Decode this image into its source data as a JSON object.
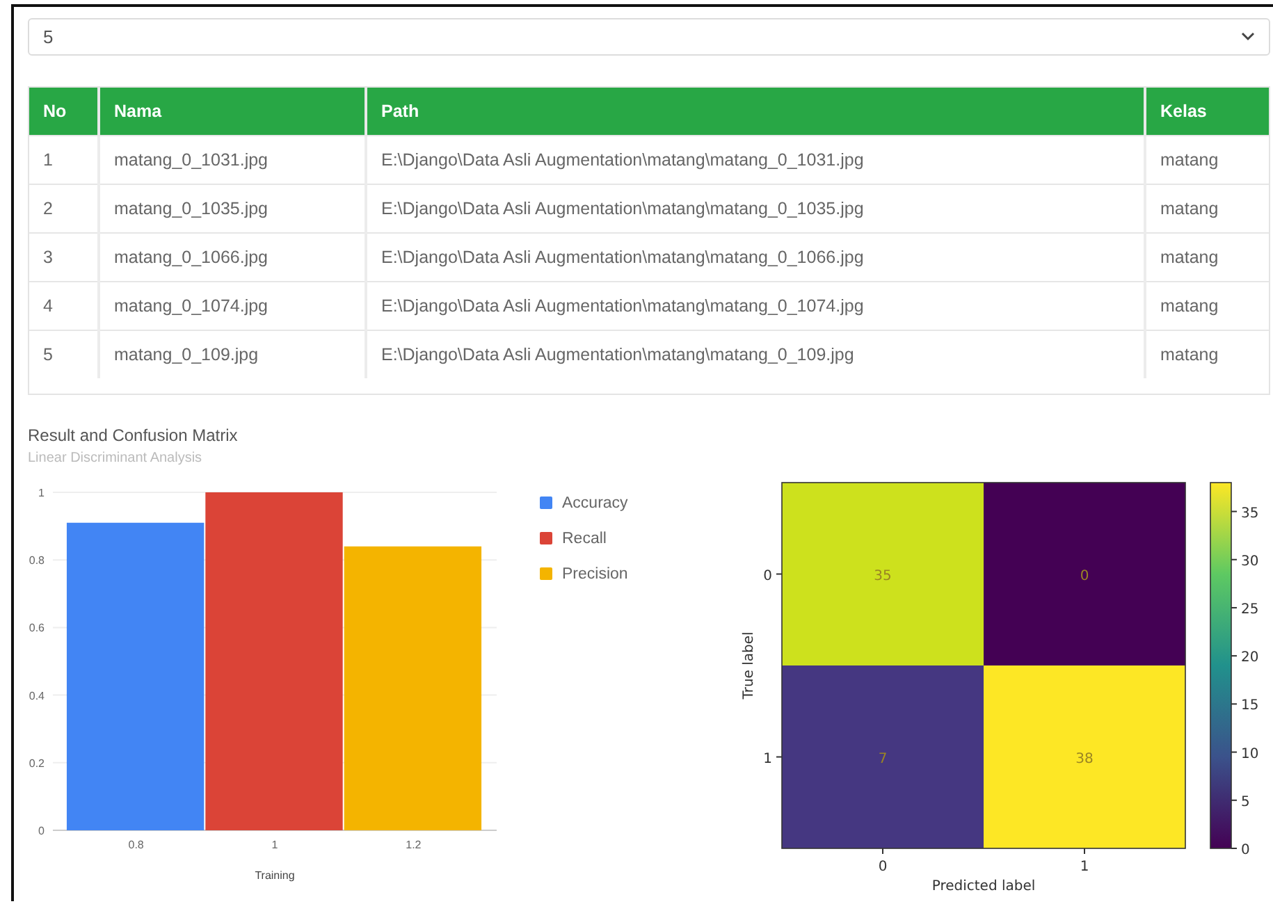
{
  "page_size_select": {
    "value": "5"
  },
  "table": {
    "columns": [
      "No",
      "Nama",
      "Path",
      "Kelas"
    ],
    "rows": [
      [
        "1",
        "matang_0_1031.jpg",
        "E:\\Django\\Data Asli Augmentation\\matang\\matang_0_1031.jpg",
        "matang"
      ],
      [
        "2",
        "matang_0_1035.jpg",
        "E:\\Django\\Data Asli Augmentation\\matang\\matang_0_1035.jpg",
        "matang"
      ],
      [
        "3",
        "matang_0_1066.jpg",
        "E:\\Django\\Data Asli Augmentation\\matang\\matang_0_1066.jpg",
        "matang"
      ],
      [
        "4",
        "matang_0_1074.jpg",
        "E:\\Django\\Data Asli Augmentation\\matang\\matang_0_1074.jpg",
        "matang"
      ],
      [
        "5",
        "matang_0_109.jpg",
        "E:\\Django\\Data Asli Augmentation\\matang\\matang_0_109.jpg",
        "matang"
      ]
    ]
  },
  "results": {
    "title": "Result and Confusion Matrix",
    "subtitle": "Linear Discriminant Analysis",
    "chart_data": {
      "type": "bar",
      "grid": true,
      "legend": "right",
      "xlabel": "Training",
      "x": [
        0.8,
        1,
        1.2
      ],
      "xlim": [
        0.68,
        1.32
      ],
      "xticks": [
        0.8,
        1,
        1.2
      ],
      "ylim": [
        0,
        1
      ],
      "yticks": [
        0,
        0.2,
        0.4,
        0.6,
        0.8,
        1
      ],
      "series": [
        {
          "name": "Accuracy",
          "color": "#4285f4",
          "values": [
            0.91,
            null,
            null
          ]
        },
        {
          "name": "Recall",
          "color": "#db4437",
          "values": [
            null,
            1,
            null
          ]
        },
        {
          "name": "Precision",
          "color": "#f4b400",
          "values": [
            null,
            null,
            0.84
          ]
        }
      ]
    }
  },
  "confusion_matrix": {
    "xlabel": "Predicted label",
    "ylabel": "True label",
    "x_ticks": [
      "0",
      "1"
    ],
    "y_ticks": [
      "0",
      "1"
    ],
    "cells": [
      [
        {
          "value": "35",
          "color": "#cde11d"
        },
        {
          "value": "0",
          "color": "#440154"
        }
      ],
      [
        {
          "value": "7",
          "color": "#453781"
        },
        {
          "value": "38",
          "color": "#fde725"
        }
      ]
    ],
    "colorbar_ticks": [
      "35",
      "30",
      "25",
      "20",
      "15",
      "10",
      "5",
      "0"
    ]
  }
}
